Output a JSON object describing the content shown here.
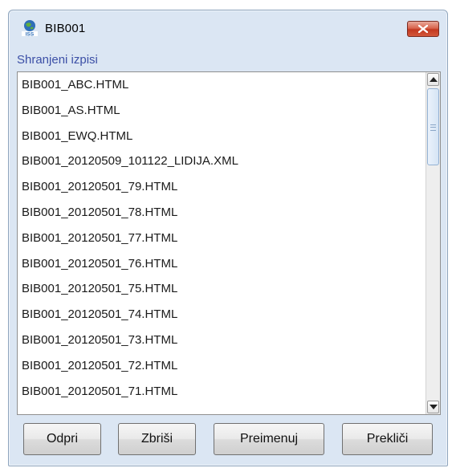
{
  "window": {
    "title": "BIB001",
    "close_label": "×"
  },
  "list": {
    "label": "Shranjeni izpisi",
    "items": [
      "BIB001_ABC.HTML",
      "BIB001_AS.HTML",
      "BIB001_EWQ.HTML",
      "BIB001_20120509_101122_LIDIJA.XML",
      "BIB001_20120501_79.HTML",
      "BIB001_20120501_78.HTML",
      "BIB001_20120501_77.HTML",
      "BIB001_20120501_76.HTML",
      "BIB001_20120501_75.HTML",
      "BIB001_20120501_74.HTML",
      "BIB001_20120501_73.HTML",
      "BIB001_20120501_72.HTML",
      "BIB001_20120501_71.HTML"
    ]
  },
  "buttons": {
    "open": "Odpri",
    "delete": "Zbriši",
    "rename": "Preimenuj",
    "cancel": "Prekliči"
  },
  "icons": {
    "app": "iss-globe-icon",
    "close": "close-icon"
  }
}
